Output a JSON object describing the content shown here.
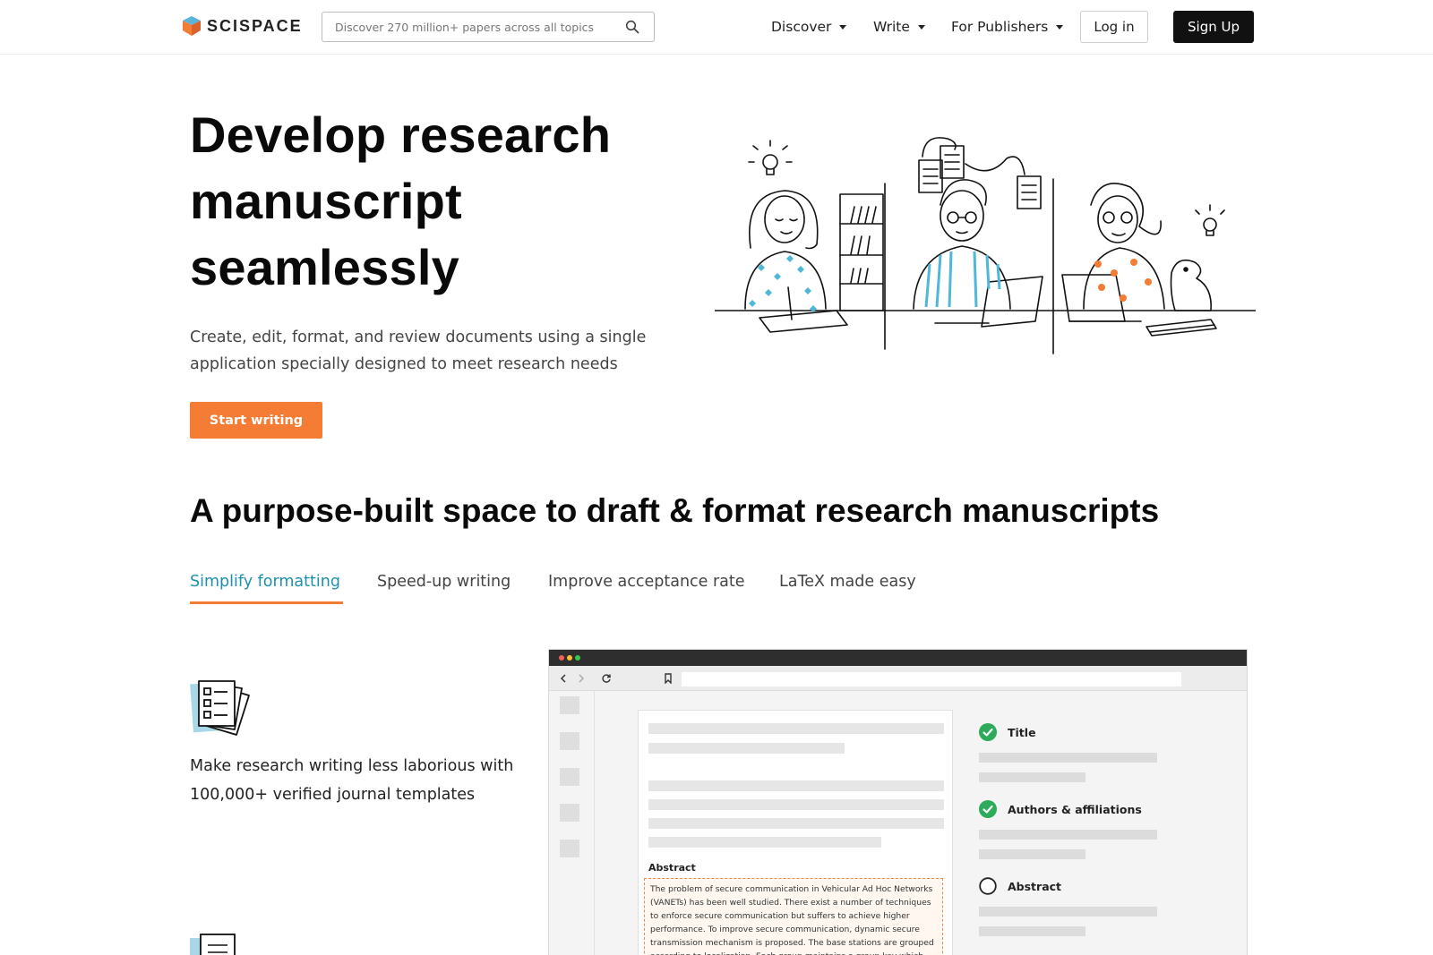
{
  "brand": {
    "name": "SCISPACE"
  },
  "search": {
    "placeholder": "Discover 270 million+ papers across all topics"
  },
  "nav": {
    "items": [
      {
        "label": "Discover"
      },
      {
        "label": "Write"
      },
      {
        "label": "For Publishers"
      }
    ],
    "login_label": "Log in",
    "signup_label": "Sign Up"
  },
  "hero": {
    "title_line1": "Develop research",
    "title_line2": "manuscript",
    "title_line3": "seamlessly",
    "subtitle": "Create, edit, format, and review documents using a single application specially designed to meet research needs",
    "cta_label": "Start writing"
  },
  "section": {
    "title": "A purpose-built space to draft & format research manuscripts",
    "tabs": [
      {
        "label": "Simplify formatting"
      },
      {
        "label": "Speed-up writing"
      },
      {
        "label": "Improve acceptance rate"
      },
      {
        "label": "LaTeX made easy"
      }
    ],
    "feature_text": "Make research writing less laborious with 100,000+ verified journal templates"
  },
  "mock": {
    "abstract_label": "Abstract",
    "abstract_text": "The problem of secure communication in Vehicular Ad Hoc Networks (VANETs) has been well studied. There exist a number of techniques to enforce secure communication but suffers to achieve higher performance. To improve secure communication, dynamic secure transmission mechanism is proposed. The base stations are grouped according to localization. Each group maintains a group key which has been shared",
    "checklist": [
      {
        "label": "Title",
        "checked": true
      },
      {
        "label": "Authors & affiliations",
        "checked": true
      },
      {
        "label": "Abstract",
        "checked": false
      }
    ]
  },
  "colors": {
    "accent": "#f47c35",
    "tab_active": "#1f8fae",
    "check_green": "#2eaa5b",
    "dark": "#111111"
  }
}
